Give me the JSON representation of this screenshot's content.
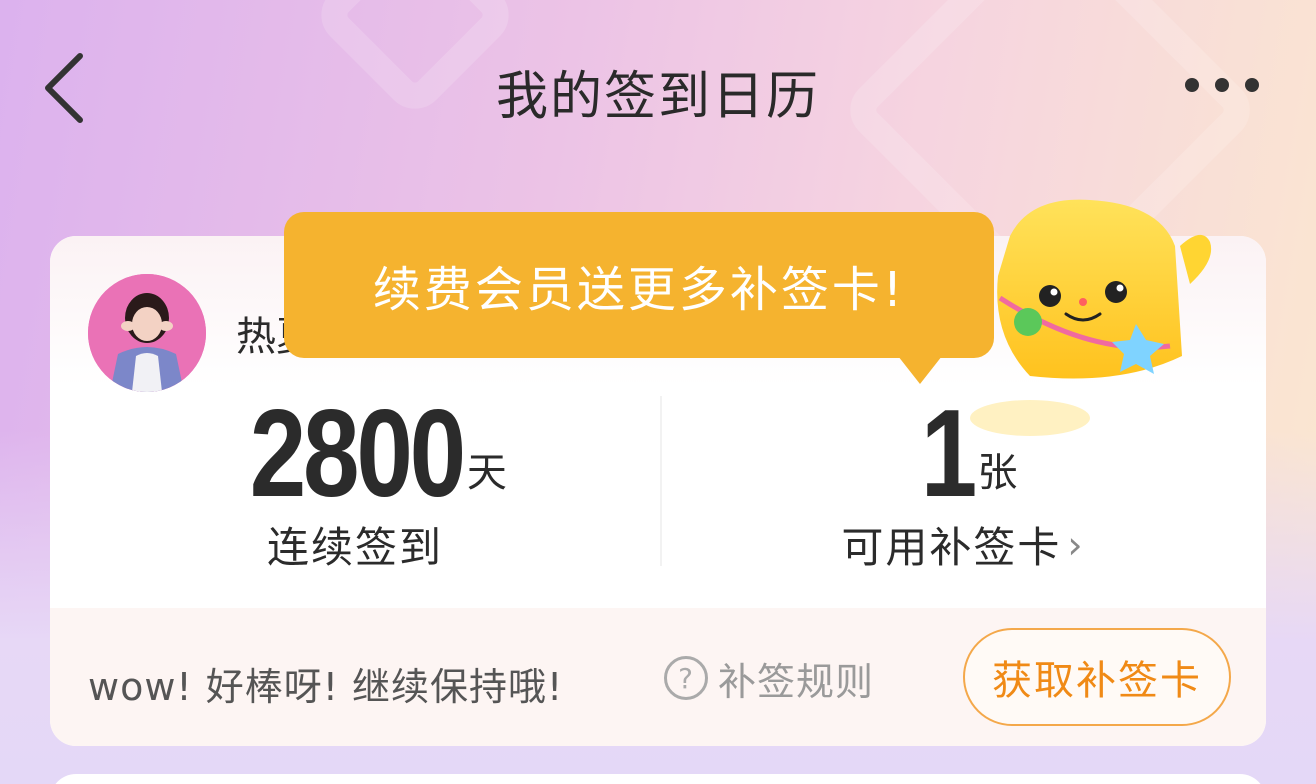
{
  "header": {
    "title": "我的签到日历",
    "back_icon": "chevron-left-icon",
    "more_icon": "more-dots-icon"
  },
  "profile": {
    "username": "热夏的风不冷",
    "avatar": "avatar"
  },
  "tooltip": {
    "text": "续费会员送更多补签卡!"
  },
  "stats": {
    "streak": {
      "value": "2800",
      "unit": "天",
      "label": "连续签到"
    },
    "cards": {
      "value": "1",
      "unit": "张",
      "label": "可用补签卡",
      "chevron": "›"
    }
  },
  "footer": {
    "cheer_text": "wow!  好棒呀!  继续保持哦!",
    "rules_icon_glyph": "?",
    "rules_label": "补签规则",
    "get_button_label": "获取补签卡"
  },
  "colors": {
    "accent": "#f5b32f",
    "button_text": "#f08a16",
    "button_border": "#f4a84a"
  }
}
